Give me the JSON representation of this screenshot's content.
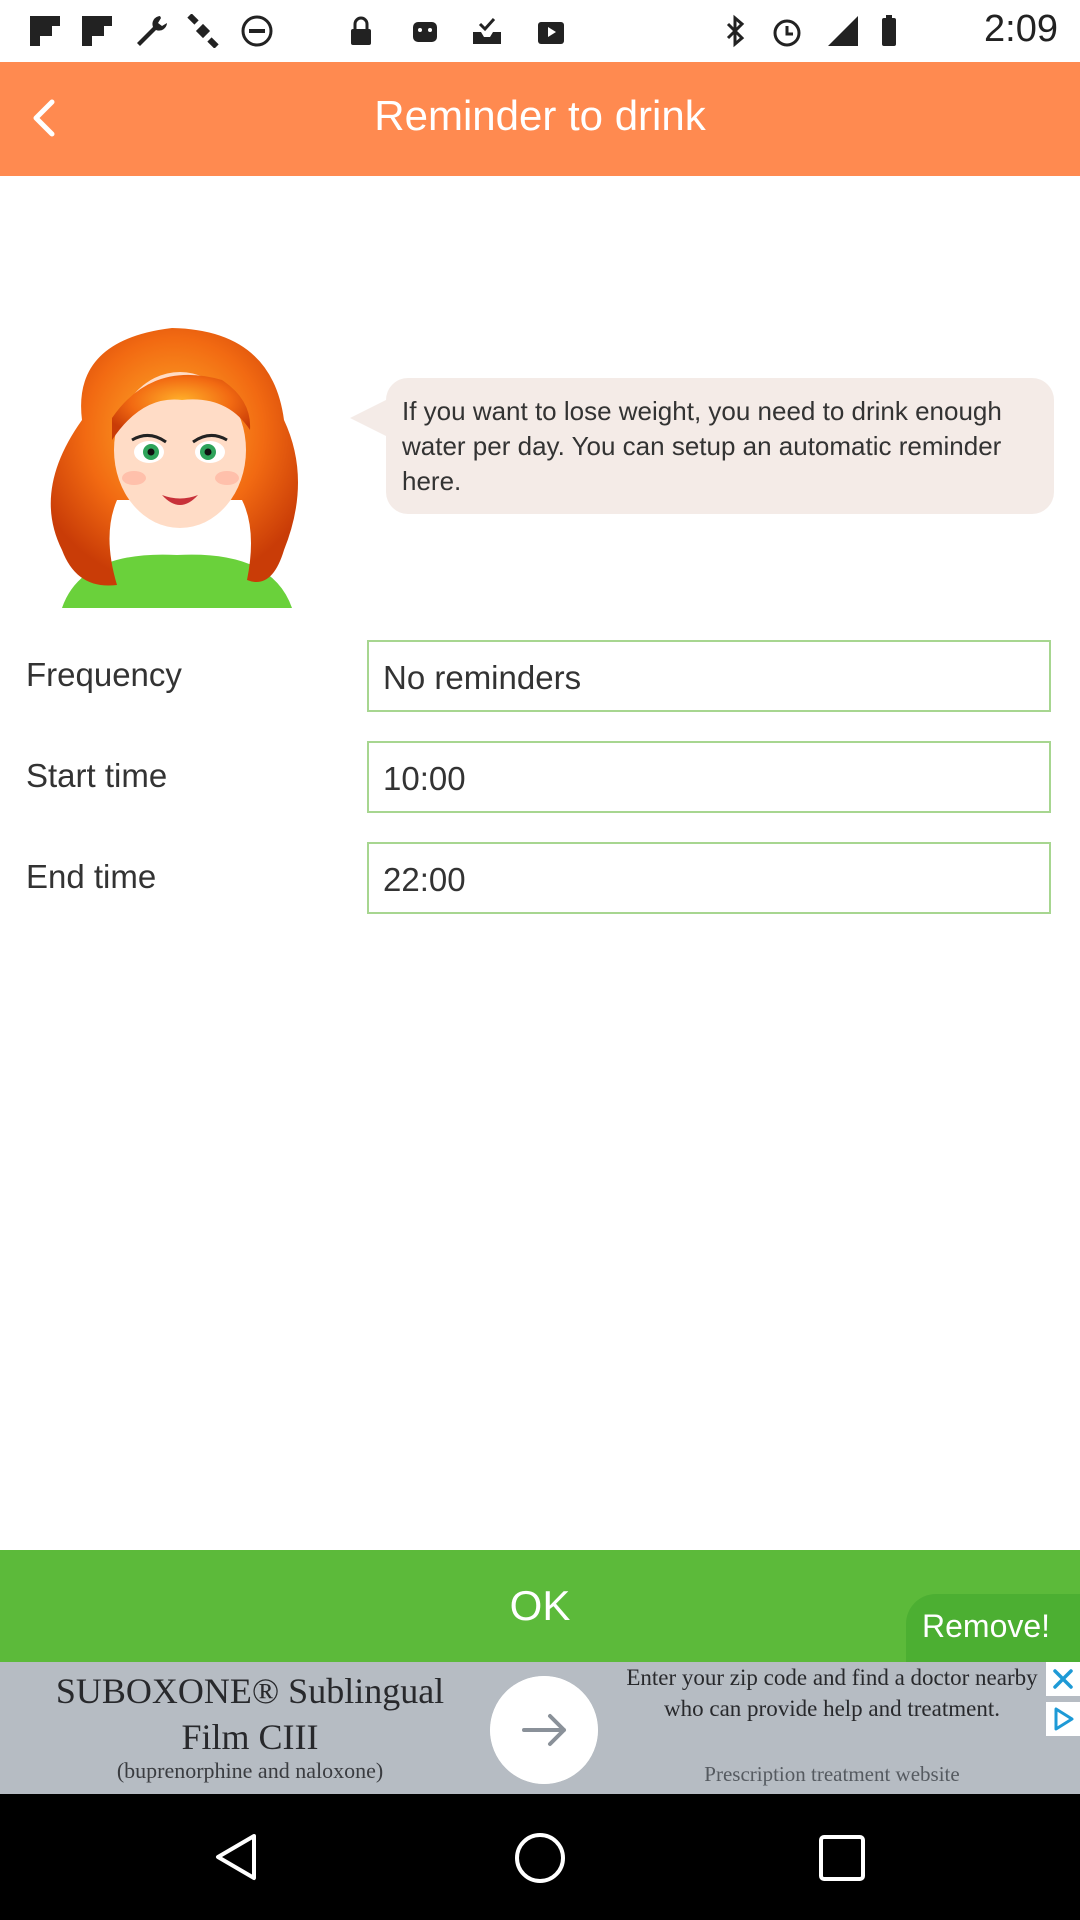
{
  "status_bar": {
    "time": "2:09",
    "icons": [
      "flipboard-icon",
      "flipboard-icon",
      "wrench-icon",
      "satellite-icon",
      "record-icon",
      "lock-icon",
      "android-icon",
      "checkbox-tray-icon",
      "play-store-icon",
      "bluetooth-icon",
      "alarm-icon",
      "signal-icon",
      "battery-icon"
    ]
  },
  "header": {
    "title": "Reminder to drink",
    "back_icon": "chevron-left-icon",
    "background": "#ff8a50"
  },
  "tip": {
    "text": "If you want to lose weight, you need to drink enough water per day. You can setup an automatic reminder here."
  },
  "form": {
    "frequency_label": "Frequency",
    "frequency_value": "No reminders",
    "start_label": "Start time",
    "start_value": "10:00",
    "end_label": "End time",
    "end_value": "22:00"
  },
  "ok_button": {
    "label": "OK",
    "color": "#5cba3a"
  },
  "remove_button": {
    "label": "Remove!"
  },
  "ad": {
    "headline": "SUBOXONE® Sublingual Film CIII",
    "subline": "(buprenorphine and naloxone)",
    "description": "Enter your zip code and find a doctor nearby who can provide help and treatment.",
    "link_text": "Prescription treatment website"
  }
}
